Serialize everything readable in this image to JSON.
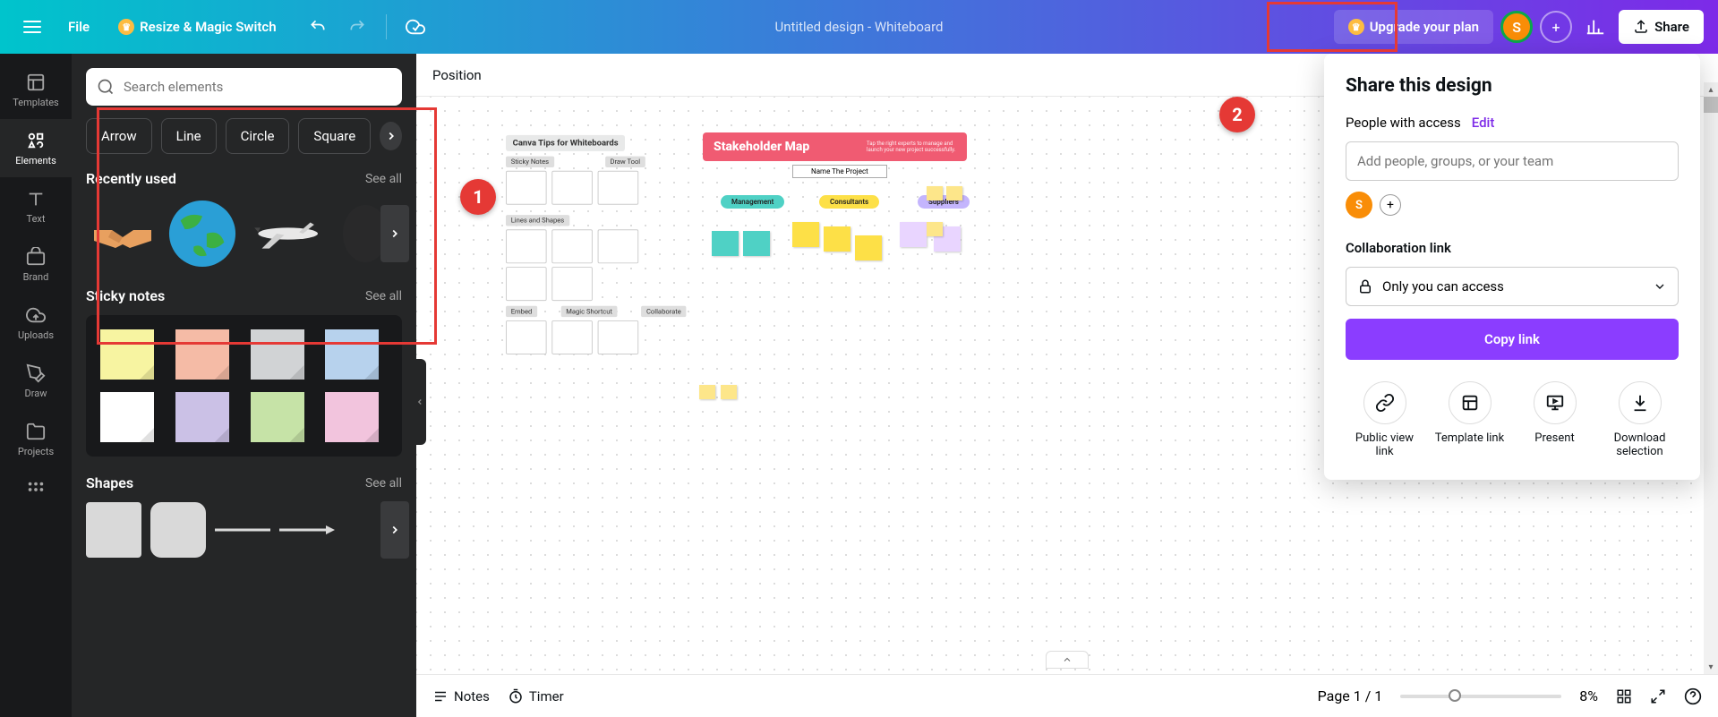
{
  "top": {
    "file": "File",
    "resize": "Resize & Magic Switch",
    "title": "Untitled design - Whiteboard",
    "upgrade": "Upgrade your plan",
    "avatar_initial": "S",
    "share": "Share"
  },
  "rail": {
    "templates": "Templates",
    "elements": "Elements",
    "text": "Text",
    "brand": "Brand",
    "uploads": "Uploads",
    "draw": "Draw",
    "projects": "Projects"
  },
  "panel": {
    "search_placeholder": "Search elements",
    "chips": {
      "arrow": "Arrow",
      "line": "Line",
      "circle": "Circle",
      "square": "Square"
    },
    "recent_title": "Recently used",
    "recent_see_all": "See all",
    "sticky_title": "Sticky notes",
    "sticky_see_all": "See all",
    "shapes_title": "Shapes",
    "shapes_see_all": "See all",
    "sticky_colors": [
      "#f7f4a1",
      "#f5bba6",
      "#d1d3d5",
      "#b7d2ed",
      "#ffffff",
      "#cbc1e6",
      "#c6e3a7",
      "#f2c4dd"
    ]
  },
  "canvas": {
    "position": "Position",
    "tips_title": "Canva Tips for Whiteboards",
    "sections": {
      "sticky": "Sticky Notes",
      "draw": "Draw Tool",
      "lines": "Lines and Shapes",
      "embed": "Embed",
      "magic": "Magic Shortcut",
      "collab": "Collaborate"
    },
    "stakeholder": {
      "title": "Stakeholder Map",
      "subtitle": "Tap the right experts to manage and launch your new project successfully.",
      "name_project": "Name The Project",
      "management": "Management",
      "consultants": "Consultants",
      "suppliers": "Suppliers"
    }
  },
  "share": {
    "title": "Share this design",
    "people_access": "People with access",
    "edit": "Edit",
    "add_placeholder": "Add people, groups, or your team",
    "avatar_initial": "S",
    "collab_label": "Collaboration link",
    "access_value": "Only you can access",
    "copy_link": "Copy link",
    "actions": {
      "public": "Public view link",
      "template": "Template link",
      "present": "Present",
      "download": "Download selection"
    }
  },
  "bottom": {
    "notes": "Notes",
    "timer": "Timer",
    "page_info": "Page 1 / 1",
    "zoom": "8%"
  },
  "markers": {
    "one": "1",
    "two": "2"
  }
}
